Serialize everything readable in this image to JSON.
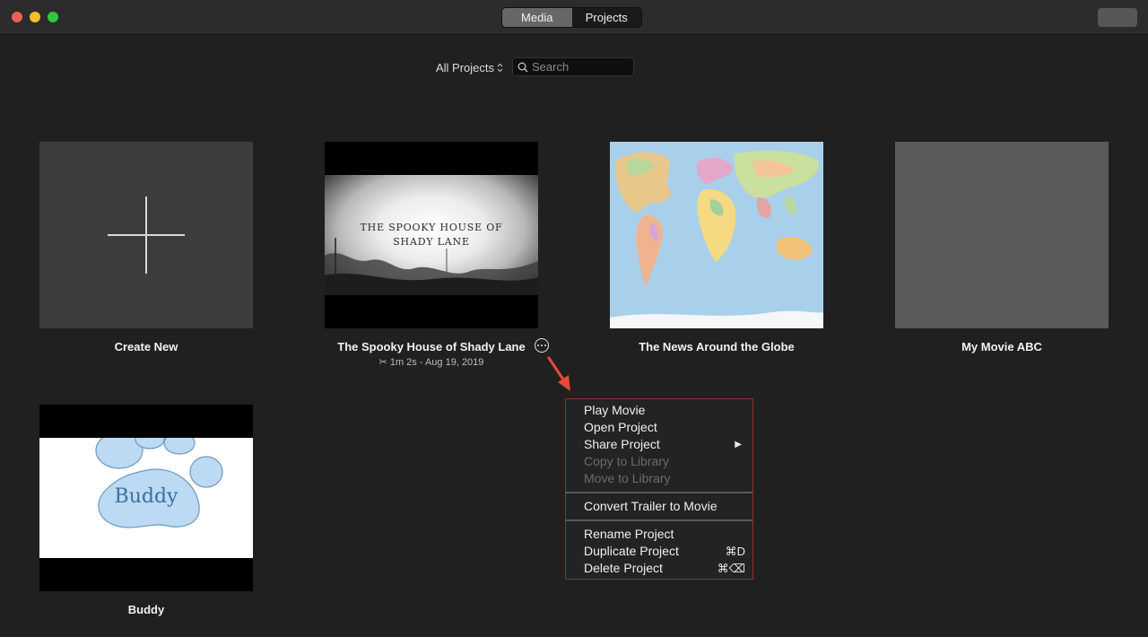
{
  "toolbar": {
    "tabs": [
      {
        "label": "Media",
        "active": true
      },
      {
        "label": "Projects",
        "active": false
      }
    ]
  },
  "filter": {
    "label": "All Projects",
    "search_placeholder": "Search"
  },
  "projects": [
    {
      "title": "Create New"
    },
    {
      "title": "The Spooky House of Shady Lane",
      "meta": "1m 2s - Aug 19, 2019",
      "thumb_text_1": "The Spooky House of",
      "thumb_text_2": "Shady Lane"
    },
    {
      "title": "The News Around the Globe"
    },
    {
      "title": "My Movie ABC"
    },
    {
      "title": "Buddy",
      "thumb_text": "Buddy"
    }
  ],
  "context_menu": {
    "items": [
      {
        "label": "Play Movie",
        "disabled": false
      },
      {
        "label": "Open Project",
        "disabled": false
      },
      {
        "label": "Share Project",
        "disabled": false,
        "submenu": true
      },
      {
        "label": "Copy to Library",
        "disabled": true
      },
      {
        "label": "Move to Library",
        "disabled": true
      },
      {
        "label": "Convert Trailer to Movie",
        "disabled": false
      },
      {
        "label": "Rename Project",
        "disabled": false
      },
      {
        "label": "Duplicate Project",
        "disabled": false,
        "shortcut": "⌘D"
      },
      {
        "label": "Delete Project",
        "disabled": false,
        "shortcut": "⌘⌫"
      }
    ]
  },
  "colors": {
    "background": "#202020",
    "menu_border": "#8d2f2f",
    "annotation_arrow": "#e8493a"
  }
}
